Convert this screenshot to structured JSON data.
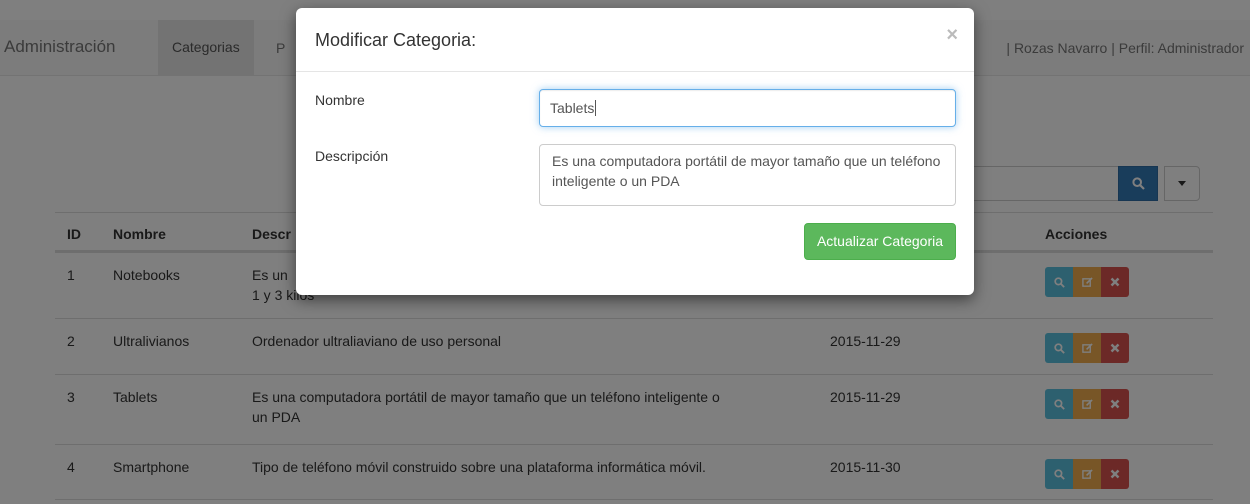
{
  "navbar": {
    "brand": "Administración",
    "links": [
      "Categorias",
      "P"
    ],
    "user": "| Rozas Navarro | Perfil: Administrador"
  },
  "table": {
    "headers": [
      "ID",
      "Nombre",
      "Descr",
      "",
      "Acciones"
    ],
    "rows": [
      {
        "id": "1",
        "name": "Notebooks",
        "desc": "Es un",
        "desc2": "1 y 3 kilos",
        "date": ""
      },
      {
        "id": "2",
        "name": "Ultralivianos",
        "desc": "Ordenador ultraliaviano de uso personal",
        "date": "2015-11-29"
      },
      {
        "id": "3",
        "name": "Tablets",
        "desc": "Es una computadora portátil de mayor tamaño que un teléfono inteligente o",
        "desc2": "un PDA",
        "date": "2015-11-29"
      },
      {
        "id": "4",
        "name": "Smartphone",
        "desc": "Tipo de teléfono móvil construido sobre una plataforma informática móvil.",
        "date": "2015-11-30"
      }
    ]
  },
  "modal": {
    "title": "Modificar Categoria:",
    "close": "×",
    "nombre_label": "Nombre",
    "nombre_value": "Tablets",
    "descripcion_label": "Descripción",
    "descripcion_value": "Es una computadora portátil de mayor tamaño que un teléfono inteligente o un PDA",
    "submit": "Actualizar Categoria"
  },
  "icons": {
    "search": "search-icon",
    "caret": "caret-down-icon",
    "view": "search-icon",
    "edit": "edit-icon",
    "delete": "close-icon"
  },
  "colors": {
    "primary": "#337ab7",
    "info": "#5bc0de",
    "warning": "#f0ad4e",
    "danger": "#d9534f",
    "success": "#5cb85c"
  }
}
